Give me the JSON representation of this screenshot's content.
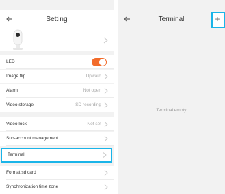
{
  "left_screen": {
    "title": "Setting",
    "back_icon": "back-arrow-icon",
    "camera_icon": "camera-icon",
    "colors": {
      "toggle_on": "#f26b2a",
      "highlight": "#1ab4e8"
    },
    "items": [
      {
        "label": "LED",
        "value": "",
        "toggle": true
      },
      {
        "label": "Image flip",
        "value": "Upward"
      },
      {
        "label": "Alarm",
        "value": "Not open"
      },
      {
        "label": "Video storage",
        "value": "SD recording"
      },
      {
        "label": "Video lock",
        "value": "Not set"
      },
      {
        "label": "Sub-account management",
        "value": ""
      },
      {
        "label": "Terminal",
        "value": ""
      },
      {
        "label": "Format sd card",
        "value": ""
      },
      {
        "label": "Synchronization time zone",
        "value": ""
      }
    ]
  },
  "right_screen": {
    "title": "Terminal",
    "add_label": "+",
    "empty_text": "Terminal empty"
  }
}
